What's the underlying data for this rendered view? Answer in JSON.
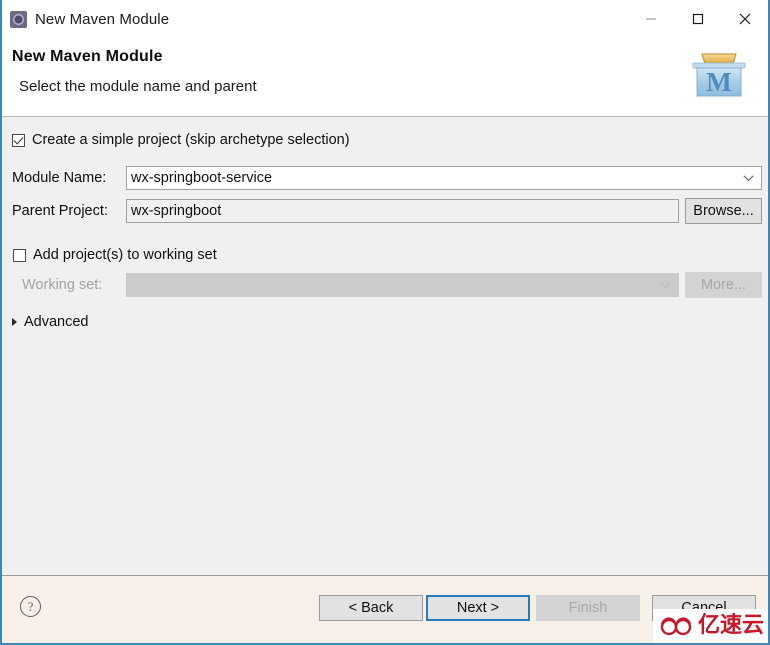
{
  "window": {
    "title": "New Maven Module",
    "icon": "maven-module-icon",
    "controls": {
      "minimize": "minimize-icon",
      "maximize": "maximize-icon",
      "close": "close-icon"
    }
  },
  "header": {
    "title": "New Maven Module",
    "subtitle": "Select the module name and parent",
    "logo": "maven-logo"
  },
  "form": {
    "simple_project": {
      "label": "Create a simple project (skip archetype selection)",
      "checked": true
    },
    "module_name": {
      "label": "Module Name:",
      "value": "wx-springboot-service"
    },
    "parent_project": {
      "label": "Parent Project:",
      "value": "wx-springboot",
      "browse_label": "Browse..."
    },
    "working_set": {
      "add_label": "Add project(s) to working set",
      "add_checked": false,
      "label": "Working set:",
      "value": "",
      "more_label": "More...",
      "disabled": true
    },
    "advanced": {
      "label": "Advanced",
      "expanded": false
    }
  },
  "footer": {
    "help": "?",
    "buttons": {
      "back": "< Back",
      "next": "Next >",
      "finish": "Finish",
      "cancel": "Cancel"
    }
  },
  "watermark": {
    "text": "亿速云"
  },
  "colors": {
    "window_border": "#3b87b8",
    "body_bg": "#f1f0ee",
    "footer_bg": "#f7f0e9",
    "focus_border": "#2a7ab9",
    "watermark_red": "#c8162a"
  }
}
